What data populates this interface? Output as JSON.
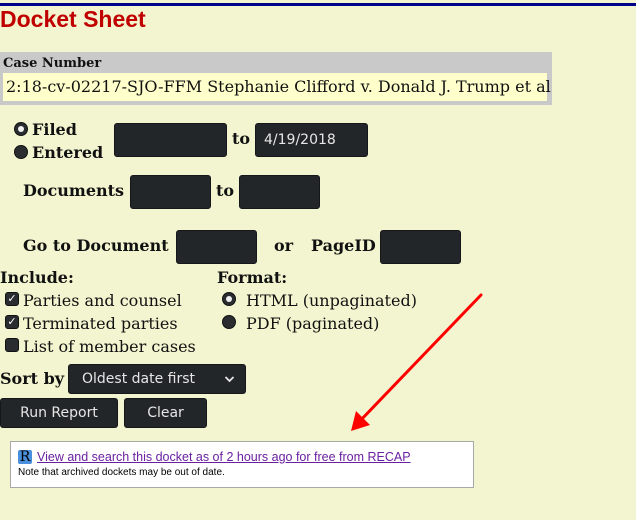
{
  "page": {
    "title": "Docket Sheet",
    "colors": {
      "background": "#f2f5cf",
      "title": "#c00000",
      "top_rule": "#00008b",
      "case_box": "#c9c9c9",
      "case_value_bg": "#ffffcc",
      "input_bg": "#232628",
      "link": "#6a1fa0",
      "annotation_arrow": "#ff0000"
    }
  },
  "case": {
    "label": "Case Number",
    "value": "2:18-cv-02217-SJO-FFM Stephanie Clifford v. Donald J. Trump et al"
  },
  "date_filter": {
    "options": [
      {
        "label": "Filed",
        "checked": true
      },
      {
        "label": "Entered",
        "checked": false
      }
    ],
    "from_value": "",
    "to_label": "to",
    "to_value": "4/19/2018"
  },
  "documents": {
    "label": "Documents",
    "from_value": "",
    "to_label": "to",
    "to_value": ""
  },
  "goto": {
    "label": "Go to Document",
    "doc_value": "",
    "or_label": "or",
    "pageid_label": "PageID",
    "pageid_value": ""
  },
  "include": {
    "heading": "Include:",
    "items": [
      {
        "label": "Parties and counsel",
        "checked": true
      },
      {
        "label": "Terminated parties",
        "checked": true
      },
      {
        "label": "List of member cases",
        "checked": false
      }
    ]
  },
  "format": {
    "heading": "Format:",
    "options": [
      {
        "label": "HTML (unpaginated)",
        "checked": true
      },
      {
        "label": "PDF (paginated)",
        "checked": false
      }
    ]
  },
  "sort": {
    "label": "Sort by",
    "selected": "Oldest date first",
    "chevron_icon": "chevron-down-icon"
  },
  "actions": {
    "run_report": "Run Report",
    "clear": "Clear"
  },
  "recap": {
    "icon": "R",
    "link_text": "View and search this docket as of 2 hours ago for free from RECAP",
    "note": "Note that archived dockets may be out of date."
  }
}
